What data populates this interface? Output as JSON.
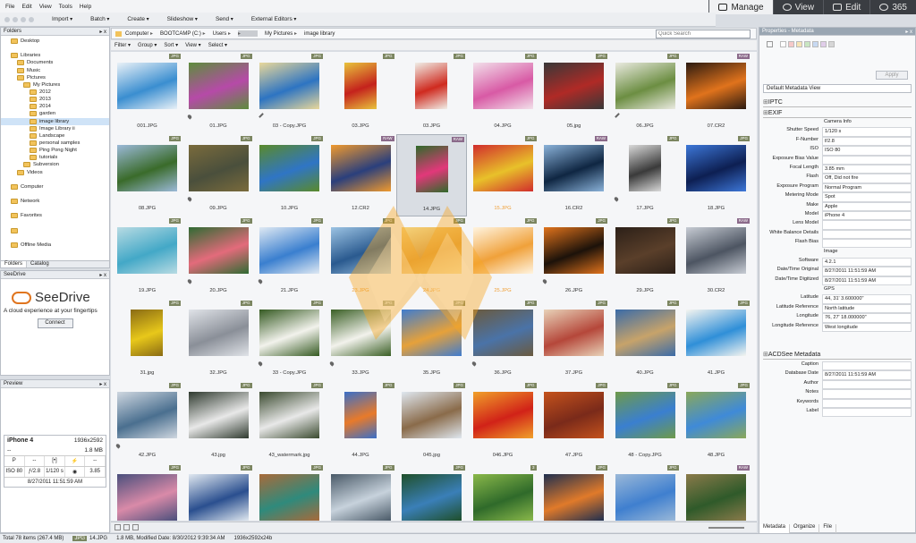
{
  "menu": [
    "File",
    "Edit",
    "View",
    "Tools",
    "Help"
  ],
  "toolbar": [
    "Import",
    "Batch",
    "Create",
    "Slideshow",
    "Send",
    "External Editors"
  ],
  "modes": [
    {
      "label": "Manage",
      "active": true
    },
    {
      "label": "View",
      "active": false
    },
    {
      "label": "Edit",
      "active": false
    },
    {
      "label": "365",
      "active": false
    }
  ],
  "folders": {
    "title": "Folders",
    "tree": [
      {
        "label": "Desktop",
        "indent": 1
      },
      {
        "label": "",
        "indent": 0
      },
      {
        "label": "Libraries",
        "indent": 1
      },
      {
        "label": "Documents",
        "indent": 2
      },
      {
        "label": "Music",
        "indent": 2
      },
      {
        "label": "Pictures",
        "indent": 2
      },
      {
        "label": "My Pictures",
        "indent": 3
      },
      {
        "label": "2012",
        "indent": 4
      },
      {
        "label": "2013",
        "indent": 4
      },
      {
        "label": "2014",
        "indent": 4
      },
      {
        "label": "garden",
        "indent": 4
      },
      {
        "label": "image library",
        "indent": 4,
        "selected": true
      },
      {
        "label": "Image Library ii",
        "indent": 4
      },
      {
        "label": "Landscape",
        "indent": 4
      },
      {
        "label": "personal samples",
        "indent": 4
      },
      {
        "label": "Ping Pong Night",
        "indent": 4
      },
      {
        "label": "tutorials",
        "indent": 4
      },
      {
        "label": "Subversion",
        "indent": 3
      },
      {
        "label": "Videos",
        "indent": 2
      },
      {
        "label": "",
        "indent": 0
      },
      {
        "label": "Computer",
        "indent": 1
      },
      {
        "label": "",
        "indent": 0
      },
      {
        "label": "Network",
        "indent": 1
      },
      {
        "label": "",
        "indent": 0
      },
      {
        "label": "Favorites",
        "indent": 1
      },
      {
        "label": "",
        "indent": 0
      },
      {
        "label": "",
        "indent": 1
      },
      {
        "label": "",
        "indent": 0
      },
      {
        "label": "Offline Media",
        "indent": 1
      }
    ],
    "tabs": [
      "Folders",
      "Catalog"
    ]
  },
  "seedrive": {
    "title": "SeeDrive",
    "name": "SeeDrive",
    "tagline": "A cloud experience at your fingertips",
    "button": "Connect"
  },
  "preview": {
    "title": "Preview",
    "camera": "iPhone 4",
    "dimensions": "1936x2592",
    "dash": "--",
    "size": "1.8 MB",
    "mode": "P",
    "iso": "ISO 80",
    "fnumber": "ƒ/2.8",
    "shutter": "1/120 s",
    "focal": "3.85",
    "date": "8/27/2011 11:51:59 AM"
  },
  "address": {
    "crumbs": [
      "Computer",
      "BOOTCAMP (C:)",
      "Users",
      "",
      "My Pictures",
      "image library"
    ],
    "search_placeholder": "Quick Search"
  },
  "filterbar": [
    "Filter",
    "Group",
    "Sort",
    "View",
    "Select"
  ],
  "grid": [
    {
      "label": "001.JPG",
      "badge": "JPG",
      "c1": "#3a8ed0",
      "c2": "#e9f1f7",
      "shape": "land"
    },
    {
      "label": "01.JPG",
      "badge": "JPG",
      "c1": "#b64aa8",
      "c2": "#5d8d3c",
      "shape": "land",
      "pin": true
    },
    {
      "label": "03 - Copy.JPG",
      "badge": "JPG",
      "c1": "#2d74c2",
      "c2": "#e9d89a",
      "shape": "land",
      "edit": true
    },
    {
      "label": "03.JPG",
      "badge": "JPG",
      "c1": "#c4221c",
      "c2": "#e8c33c",
      "shape": "port"
    },
    {
      "label": "03.JPG",
      "badge": "JPG",
      "c1": "#cf2a1f",
      "c2": "#f0eee7",
      "shape": "port"
    },
    {
      "label": "04.JPG",
      "badge": "JPG",
      "c1": "#d85aa5",
      "c2": "#f2e0ea",
      "shape": "land"
    },
    {
      "label": "05.jpg",
      "badge": "JPG",
      "c1": "#b02a26",
      "c2": "#383838",
      "shape": "land"
    },
    {
      "label": "06.JPG",
      "badge": "JPG",
      "c1": "#6c8e42",
      "c2": "#eaeae0",
      "shape": "land",
      "edit": true
    },
    {
      "label": "07.CR2",
      "badge": "RAW",
      "c1": "#e0731c",
      "c2": "#2b1a10",
      "shape": "land"
    },
    {
      "label": "08.JPG",
      "badge": "JPG",
      "c1": "#3a6b2a",
      "c2": "#9bb9d8",
      "shape": "land"
    },
    {
      "label": "09.JPG",
      "badge": "JPG",
      "c1": "#4a4f3c",
      "c2": "#7a6b3c",
      "shape": "land",
      "pin": true
    },
    {
      "label": "10.JPG",
      "badge": "JPG",
      "c1": "#2f75c5",
      "c2": "#5a8a2b",
      "shape": "land"
    },
    {
      "label": "12.CR2",
      "badge": "RAW",
      "c1": "#2a3f7c",
      "c2": "#f09a2e",
      "shape": "land"
    },
    {
      "label": "14.JPG",
      "badge": "RAW",
      "c1": "#e2387a",
      "c2": "#2f6a2a",
      "shape": "port",
      "selected": true
    },
    {
      "label": "15.JPG",
      "badge": "JPG",
      "c1": "#e8c12a",
      "c2": "#d12d2d",
      "shape": "land",
      "orange": true
    },
    {
      "label": "16.CR2",
      "badge": "RAW",
      "c1": "#0f2642",
      "c2": "#8ab2d9",
      "shape": "land"
    },
    {
      "label": "17.JPG",
      "badge": "JPG",
      "c1": "#3a3a3a",
      "c2": "#d9d9d9",
      "shape": "port",
      "pin": true
    },
    {
      "label": "18.JPG",
      "badge": "JPG",
      "c1": "#0d1f52",
      "c2": "#3d77d8",
      "shape": "land"
    },
    {
      "label": "19.JPG",
      "badge": "JPG",
      "c1": "#43a8c7",
      "c2": "#b8dbe3",
      "shape": "land"
    },
    {
      "label": "20.JPG",
      "badge": "JPG",
      "c1": "#e36b7b",
      "c2": "#2f6b33",
      "shape": "land",
      "pin": true
    },
    {
      "label": "21.JPG",
      "badge": "JPG",
      "c1": "#3a7fcf",
      "c2": "#dfe9f3",
      "shape": "land",
      "pin": true
    },
    {
      "label": "23.JPG",
      "badge": "JPG",
      "c1": "#2a5a8f",
      "c2": "#9cc3e3",
      "shape": "land",
      "orange": true
    },
    {
      "label": "24.JPG",
      "badge": "JPG",
      "c1": "#e3a13a",
      "c2": "#f5d27a",
      "shape": "land",
      "orange": true
    },
    {
      "label": "25.JPG",
      "badge": "JPG",
      "c1": "#f0a13a",
      "c2": "#fff4e0",
      "shape": "land",
      "orange": true
    },
    {
      "label": "26.JPG",
      "badge": "JPG",
      "c1": "#1c120a",
      "c2": "#e0731c",
      "shape": "land",
      "pin": true
    },
    {
      "label": "29.JPG",
      "badge": "JPG",
      "c1": "#5a3f2a",
      "c2": "#2c2018",
      "shape": "land"
    },
    {
      "label": "30.CR2",
      "badge": "RAW",
      "c1": "#4d5562",
      "c2": "#c7ccd4",
      "shape": "land"
    },
    {
      "label": "31.jpg",
      "badge": "JPG",
      "c1": "#e8c81a",
      "c2": "#8a6b14",
      "shape": "port"
    },
    {
      "label": "32.JPG",
      "badge": "JPG",
      "c1": "#8a8f98",
      "c2": "#e0e3e8",
      "shape": "land"
    },
    {
      "label": "33 - Copy.JPG",
      "badge": "JPG",
      "c1": "#f2f2ec",
      "c2": "#355a22",
      "shape": "land",
      "pin": true
    },
    {
      "label": "33.JPG",
      "badge": "JPG",
      "c1": "#f2f2ec",
      "c2": "#3a5f25",
      "shape": "land",
      "pin": true
    },
    {
      "label": "35.JPG",
      "badge": "JPG",
      "c1": "#e6a13a",
      "c2": "#3f7ccf",
      "shape": "land"
    },
    {
      "label": "36.JPG",
      "badge": "JPG",
      "c1": "#4a73a8",
      "c2": "#6a5a3f",
      "shape": "land",
      "pin": true
    },
    {
      "label": "37.JPG",
      "badge": "JPG",
      "c1": "#b5473a",
      "c2": "#e8d2b8",
      "shape": "land"
    },
    {
      "label": "40.JPG",
      "badge": "JPG",
      "c1": "#c7a36a",
      "c2": "#3a6ba8",
      "shape": "land"
    },
    {
      "label": "41.JPG",
      "badge": "JPG",
      "c1": "#2f8fd8",
      "c2": "#f5f5f0",
      "shape": "land"
    },
    {
      "label": "42.JPG",
      "badge": "JPG",
      "c1": "#4a6f8f",
      "c2": "#cfd7e0",
      "shape": "land",
      "pin": true
    },
    {
      "label": "43.jpg",
      "badge": "JPG",
      "c1": "#e8e8e8",
      "c2": "#2f3a2f",
      "shape": "land"
    },
    {
      "label": "43_watermark.jpg",
      "badge": "JPG",
      "c1": "#e8e8e8",
      "c2": "#3a4a2f",
      "shape": "land"
    },
    {
      "label": "44.JPG",
      "badge": "JPG",
      "c1": "#e87a2a",
      "c2": "#3a6fc8",
      "shape": "port"
    },
    {
      "label": "045.jpg",
      "badge": "JPG",
      "c1": "#8a6b4a",
      "c2": "#dfe7ef",
      "shape": "land"
    },
    {
      "label": "046.JPG",
      "badge": "JPG",
      "c1": "#d12218",
      "c2": "#f0a02a",
      "shape": "land"
    },
    {
      "label": "47.JPG",
      "badge": "JPG",
      "c1": "#7a2a1a",
      "c2": "#c4521c",
      "shape": "land"
    },
    {
      "label": "48 - Copy.JPG",
      "badge": "JPG",
      "c1": "#3a7fd0",
      "c2": "#6e9a4a",
      "shape": "land"
    },
    {
      "label": "48.JPG",
      "badge": "JPG",
      "c1": "#3f8ad8",
      "c2": "#8aa85a",
      "shape": "land"
    },
    {
      "label": "",
      "badge": "JPG",
      "c1": "#d98aa8",
      "c2": "#4a4f7c",
      "shape": "land"
    },
    {
      "label": "",
      "badge": "JPG",
      "c1": "#2a4f8f",
      "c2": "#e0e8f0",
      "shape": "land"
    },
    {
      "label": "",
      "badge": "JPG",
      "c1": "#2f8a7c",
      "c2": "#a86a3a",
      "shape": "land"
    },
    {
      "label": "",
      "badge": "JPG",
      "c1": "#c7d2dc",
      "c2": "#4a5a68",
      "shape": "land"
    },
    {
      "label": "",
      "badge": "JPG",
      "c1": "#3a7fb8",
      "c2": "#1f4f2a",
      "shape": "land"
    },
    {
      "label": "",
      "badge": "3",
      "c1": "#2f6a2a",
      "c2": "#8ab84a",
      "shape": "land"
    },
    {
      "label": "",
      "badge": "JPG",
      "c1": "#e07a2a",
      "c2": "#1f2f4f",
      "shape": "land"
    },
    {
      "label": "",
      "badge": "JPG",
      "c1": "#3f7fcf",
      "c2": "#9ab8d8",
      "shape": "land"
    },
    {
      "label": "",
      "badge": "RAW",
      "c1": "#2f5a2a",
      "c2": "#8a7a4a",
      "shape": "land"
    }
  ],
  "properties": {
    "title": "Properties - Metadata",
    "apply": "Apply",
    "metadata_view": "Default Metadata View",
    "sections": {
      "iptc": "IPTC",
      "exif": "EXIF",
      "acdsee": "ACDSee Metadata"
    },
    "exif": [
      {
        "k": "",
        "v": "Camera Info",
        "group": true
      },
      {
        "k": "Shutter Speed",
        "v": "1/120 s"
      },
      {
        "k": "F-Number",
        "v": "f/2.8"
      },
      {
        "k": "ISO",
        "v": "ISO 80"
      },
      {
        "k": "Exposure Bias Value",
        "v": ""
      },
      {
        "k": "Focal Length",
        "v": "3.85 mm"
      },
      {
        "k": "Flash",
        "v": "Off, Did not fire"
      },
      {
        "k": "Exposure Program",
        "v": "Normal Program"
      },
      {
        "k": "Metering Mode",
        "v": "Spot"
      },
      {
        "k": "Make",
        "v": "Apple"
      },
      {
        "k": "Model",
        "v": "iPhone 4"
      },
      {
        "k": "Lens Model",
        "v": ""
      },
      {
        "k": "White Balance Details",
        "v": ""
      },
      {
        "k": "Flash Bias",
        "v": ""
      },
      {
        "k": "",
        "v": "Image",
        "group": true
      },
      {
        "k": "Software",
        "v": "4.2.1"
      },
      {
        "k": "Date/Time Original",
        "v": "8/27/2011 11:51:59 AM"
      },
      {
        "k": "Date/Time Digitized",
        "v": "8/27/2011 11:51:59 AM"
      },
      {
        "k": "",
        "v": "GPS",
        "group": true
      },
      {
        "k": "Latitude",
        "v": "44, 31' 3.600000\""
      },
      {
        "k": "Latitude Reference",
        "v": "North latitude"
      },
      {
        "k": "Longitude",
        "v": "76, 27' 18.000000\""
      },
      {
        "k": "Longitude Reference",
        "v": "West longitude"
      }
    ],
    "acdsee": [
      {
        "k": "Caption",
        "v": ""
      },
      {
        "k": "Database Date",
        "v": "8/27/2011 11:51:59 AM"
      },
      {
        "k": "Author",
        "v": ""
      },
      {
        "k": "Notes",
        "v": ""
      },
      {
        "k": "Keywords",
        "v": ""
      },
      {
        "k": "Label",
        "v": ""
      }
    ],
    "tabs": [
      "Metadata",
      "Organize",
      "File"
    ]
  },
  "status": {
    "total": "Total 78 items  (267.4 MB)",
    "badge": "JPG",
    "file": "14.JPG",
    "info": "1.8 MB, Modified Date: 8/30/2012 9:39:34 AM",
    "dims": "1936x2592x24b"
  }
}
